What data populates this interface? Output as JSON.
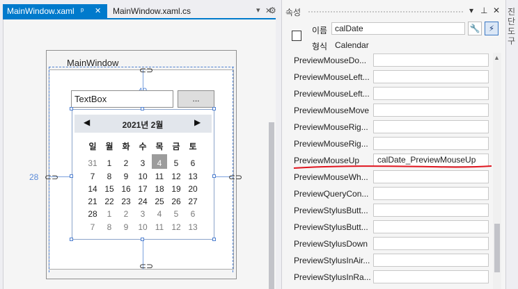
{
  "tabs": [
    {
      "label": "MainWindow.xaml",
      "active": true
    },
    {
      "label": "MainWindow.xaml.cs",
      "active": false
    }
  ],
  "designer": {
    "window_title": "MainWindow",
    "textbox_text": "TextBox",
    "browse_label": "...",
    "margin_top": "49",
    "margin_left": "28",
    "calendar": {
      "title": "2021년 2월",
      "weekdays": [
        "일",
        "월",
        "화",
        "수",
        "목",
        "금",
        "토"
      ],
      "weeks": [
        [
          "31",
          "1",
          "2",
          "3",
          "4",
          "5",
          "6"
        ],
        [
          "7",
          "8",
          "9",
          "10",
          "11",
          "12",
          "13"
        ],
        [
          "14",
          "15",
          "16",
          "17",
          "18",
          "19",
          "20"
        ],
        [
          "21",
          "22",
          "23",
          "24",
          "25",
          "26",
          "27"
        ],
        [
          "28",
          "1",
          "2",
          "3",
          "4",
          "5",
          "6"
        ],
        [
          "7",
          "8",
          "9",
          "10",
          "11",
          "12",
          "13"
        ]
      ],
      "today": "4"
    }
  },
  "properties": {
    "title": "속성",
    "name_label": "이름",
    "name_value": "calDate",
    "type_label": "형식",
    "type_value": "Calendar",
    "rows": [
      {
        "name": "PreviewMouseDo...",
        "value": ""
      },
      {
        "name": "PreviewMouseLeft...",
        "value": ""
      },
      {
        "name": "PreviewMouseLeft...",
        "value": ""
      },
      {
        "name": "PreviewMouseMove",
        "value": ""
      },
      {
        "name": "PreviewMouseRig...",
        "value": ""
      },
      {
        "name": "PreviewMouseRig...",
        "value": ""
      },
      {
        "name": "PreviewMouseUp",
        "value": "calDate_PreviewMouseUp"
      },
      {
        "name": "PreviewMouseWh...",
        "value": ""
      },
      {
        "name": "PreviewQueryCon...",
        "value": ""
      },
      {
        "name": "PreviewStylusButt...",
        "value": ""
      },
      {
        "name": "PreviewStylusButt...",
        "value": ""
      },
      {
        "name": "PreviewStylusDown",
        "value": ""
      },
      {
        "name": "PreviewStylusInAir...",
        "value": ""
      },
      {
        "name": "PreviewStylusInRa...",
        "value": ""
      }
    ]
  },
  "side_strip": {
    "label": "진단 도구"
  },
  "colors": {
    "accent": "#007acc",
    "annotation": "#e0141e",
    "guide": "#4d7fd0"
  }
}
